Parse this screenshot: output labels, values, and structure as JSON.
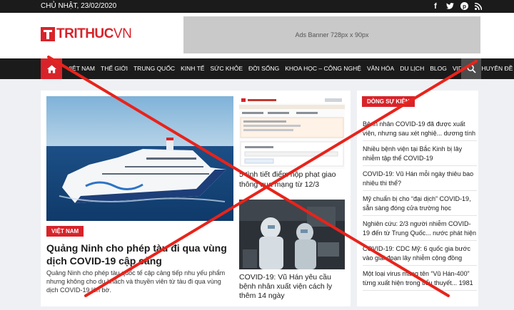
{
  "topbar": {
    "date": "CHỦ NHẬT, 23/02/2020",
    "social_icons": [
      "facebook-icon",
      "twitter-icon",
      "pinterest-icon",
      "rss-icon"
    ]
  },
  "header": {
    "logo_bold": "TRITHUC",
    "logo_light": "VN",
    "ad_text": "Ads Banner 728px x 90px"
  },
  "nav": {
    "items": [
      "VIỆT NAM",
      "THẾ GIỚI",
      "TRUNG QUỐC",
      "KINH TẾ",
      "SỨC KHỎE",
      "ĐỜI SỐNG",
      "KHOA HỌC – CÔNG NGHỆ",
      "VĂN HÓA",
      "DU LỊCH",
      "BLOG",
      "VIDEO",
      "CHUYÊN ĐỀ"
    ]
  },
  "main": {
    "tag": "VIỆT NAM",
    "title": "Quảng Ninh cho phép tàu đi qua vùng dịch COVID-19 cập cảng",
    "desc": "Quảng Ninh cho phép tàu quốc tế cập cảng tiếp nhu yếu phẩm nhưng không cho du khách và thuyền viên từ tàu đi qua vùng dịch COVID-19 lên bờ.",
    "side1_title": "5 tình tiết điểm nộp phạt giao thông qua mạng từ 12/3",
    "side2_title": "COVID-19: Vũ Hán yêu cầu bệnh nhân xuất viện cách ly thêm 14 ngày"
  },
  "sidebar": {
    "header": "DÒNG SỰ KIỆN",
    "items": [
      "Bệnh nhân COVID-19 đã được xuất viện, nhưng sau xét nghiệ... dương tính",
      "Nhiều bệnh viện tại Bắc Kinh bị lây nhiễm tập thể COVID-19",
      "COVID-19: Vũ Hán mỗi ngày thiêu bao nhiêu thi thể?",
      "Mỹ chuẩn bị cho “đại dịch” COVID-19, sẵn sàng đóng cửa trường học",
      "Nghiên cứu: 2/3 người nhiễm COVID-19 đến từ Trung Quốc... nước phát hiện",
      "COVID-19: CDC Mỹ: 6 quốc gia bước vào giai đoạn lây nhiễm cộng đồng",
      "Một loại virus mang tên “Vũ Hán-400” từng xuất hiện trong tiểu thuyết... 1981"
    ]
  },
  "colors": {
    "brand_red": "#d8232a",
    "nav_bg": "#1b1b1b",
    "x_overlay": "#e8231b"
  }
}
